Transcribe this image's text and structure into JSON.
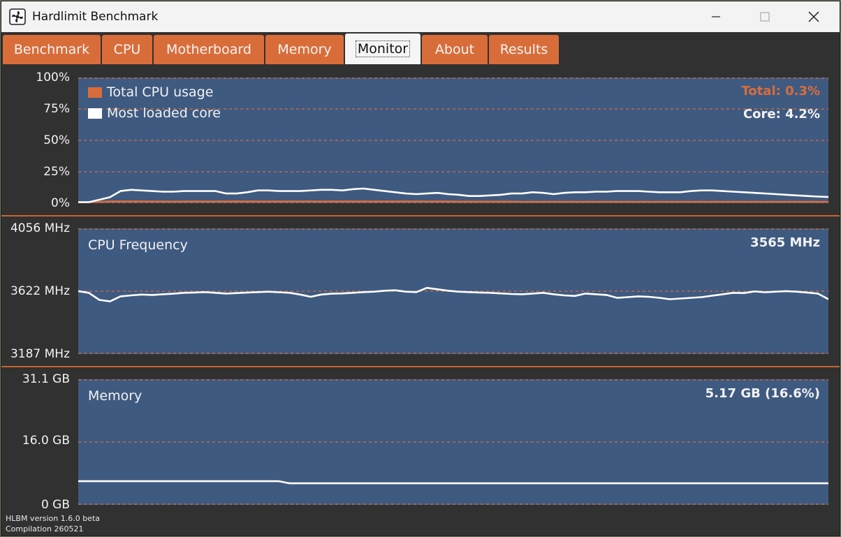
{
  "window": {
    "title": "Hardlimit Benchmark"
  },
  "titlebar_icons": {
    "app": "fan-icon",
    "minimize": "minimize-icon",
    "maximize": "maximize-icon",
    "close": "close-icon"
  },
  "tabs": [
    {
      "label": "Benchmark"
    },
    {
      "label": "CPU"
    },
    {
      "label": "Motherboard"
    },
    {
      "label": "Memory"
    },
    {
      "label": "Monitor",
      "active": true
    },
    {
      "label": "About"
    },
    {
      "label": "Results"
    }
  ],
  "colors": {
    "accent": "#d96d3a",
    "plot_bg": "#3f5a80",
    "grid": "#d96d3a",
    "line_white": "#ffffff"
  },
  "cpu_usage": {
    "y_ticks": [
      "100%",
      "75%",
      "50%",
      "25%",
      "0%"
    ],
    "legend": {
      "total": "Total CPU usage",
      "core": "Most loaded core"
    },
    "total_readout": "Total: 0.3%",
    "core_readout": "Core:  4.2%"
  },
  "cpu_frequency": {
    "title": "CPU Frequency",
    "y_ticks": [
      "4056 MHz",
      "3622 MHz",
      "3187 MHz"
    ],
    "readout": "3565 MHz"
  },
  "memory": {
    "title": "Memory",
    "y_ticks": [
      "31.1 GB",
      "16.0 GB",
      "0 GB"
    ],
    "readout": "5.17 GB  (16.6%)"
  },
  "footer": {
    "version": "HLBM version 1.6.0 beta",
    "compilation": "Compilation 260521"
  },
  "chart_data": [
    {
      "type": "line",
      "name": "cpu_usage",
      "ylim": [
        0,
        100
      ],
      "grid": true,
      "legend_position": "top-left",
      "series": [
        {
          "name": "Total CPU usage",
          "color": "#d96d3a",
          "values": [
            0,
            0,
            0.3,
            0.5,
            0.6,
            0.6,
            0.5,
            0.5,
            0.5,
            0.4,
            0.5,
            0.5,
            0.5,
            0.5,
            0.5,
            0.6,
            0.5,
            0.5,
            0.5,
            0.5,
            0.5,
            0.5,
            0.5,
            0.5,
            0.5,
            0.5,
            0.5,
            0.5,
            0.5,
            0.5,
            0.5,
            0.5,
            0.5,
            0.5,
            0.5,
            0.5,
            0.4,
            0.4,
            0.4,
            0.4,
            0.4,
            0.4,
            0.3,
            0.3,
            0.3,
            0.3,
            0.3,
            0.3,
            0.3,
            0.3,
            0.3,
            0.3,
            0.3,
            0.3,
            0.3,
            0.3,
            0.3,
            0.3,
            0.3,
            0.3,
            0.3,
            0.3,
            0.3,
            0.3,
            0.3,
            0.3,
            0.3,
            0.3,
            0.3,
            0.3,
            0.3,
            0.3
          ]
        },
        {
          "name": "Most loaded core",
          "color": "#ffffff",
          "values": [
            0,
            0,
            2,
            4,
            9,
            10,
            9.5,
            9,
            8.5,
            8.5,
            9,
            9,
            9,
            9,
            7,
            7,
            8,
            9.5,
            9.5,
            9,
            9,
            9,
            9.5,
            10,
            10,
            9.5,
            10.5,
            11,
            10,
            9,
            8,
            7,
            6.5,
            7,
            7.5,
            6.5,
            6,
            5,
            5,
            5.5,
            6,
            7,
            7,
            8,
            7.5,
            6.5,
            7.5,
            8,
            8,
            8.5,
            8.5,
            9,
            9,
            9,
            8.5,
            8,
            8,
            8,
            9,
            9.5,
            9.5,
            9,
            8.5,
            8,
            7.5,
            7,
            6.5,
            6,
            5.5,
            5,
            4.5,
            4.2
          ]
        }
      ]
    },
    {
      "type": "line",
      "name": "cpu_frequency",
      "ylim": [
        3187,
        4056
      ],
      "grid": true,
      "series": [
        {
          "name": "CPU Frequency",
          "color": "#ffffff",
          "values": [
            3622,
            3610,
            3560,
            3550,
            3585,
            3592,
            3598,
            3595,
            3600,
            3604,
            3610,
            3612,
            3615,
            3610,
            3605,
            3608,
            3612,
            3615,
            3618,
            3614,
            3610,
            3598,
            3582,
            3598,
            3604,
            3606,
            3610,
            3615,
            3618,
            3625,
            3628,
            3618,
            3615,
            3645,
            3635,
            3625,
            3618,
            3615,
            3612,
            3610,
            3606,
            3602,
            3600,
            3605,
            3610,
            3600,
            3592,
            3588,
            3605,
            3600,
            3595,
            3575,
            3580,
            3585,
            3582,
            3575,
            3565,
            3570,
            3575,
            3580,
            3590,
            3600,
            3610,
            3608,
            3620,
            3614,
            3618,
            3622,
            3618,
            3612,
            3605,
            3565
          ]
        }
      ]
    },
    {
      "type": "line",
      "name": "memory",
      "ylim": [
        0,
        31.1
      ],
      "grid": true,
      "series": [
        {
          "name": "Memory",
          "color": "#ffffff",
          "values": [
            5.7,
            5.7,
            5.7,
            5.7,
            5.7,
            5.7,
            5.7,
            5.7,
            5.7,
            5.7,
            5.7,
            5.7,
            5.7,
            5.7,
            5.7,
            5.7,
            5.7,
            5.7,
            5.7,
            5.7,
            5.17,
            5.17,
            5.17,
            5.17,
            5.17,
            5.17,
            5.17,
            5.17,
            5.17,
            5.17,
            5.17,
            5.17,
            5.17,
            5.17,
            5.17,
            5.17,
            5.17,
            5.17,
            5.17,
            5.17,
            5.17,
            5.17,
            5.17,
            5.17,
            5.17,
            5.17,
            5.17,
            5.17,
            5.17,
            5.17,
            5.17,
            5.17,
            5.17,
            5.17,
            5.17,
            5.17,
            5.17,
            5.17,
            5.17,
            5.17,
            5.17,
            5.17,
            5.17,
            5.17,
            5.17,
            5.17,
            5.17,
            5.17,
            5.17,
            5.17,
            5.17,
            5.17
          ]
        }
      ]
    }
  ]
}
